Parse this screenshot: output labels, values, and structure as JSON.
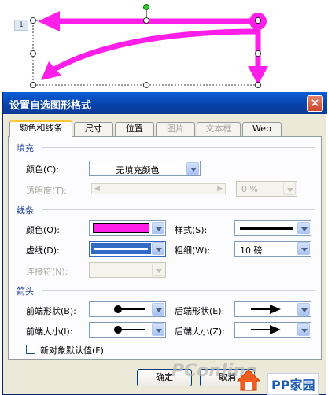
{
  "canvas": {
    "page_number": "1",
    "arrow_color": "#ff1fe8"
  },
  "dialog": {
    "title": "设置自选图形格式",
    "close_label": "×",
    "tabs": [
      {
        "label": "颜色和线条",
        "active": true,
        "disabled": false
      },
      {
        "label": "尺寸",
        "active": false,
        "disabled": false
      },
      {
        "label": "位置",
        "active": false,
        "disabled": false
      },
      {
        "label": "图片",
        "active": false,
        "disabled": true
      },
      {
        "label": "文本框",
        "active": false,
        "disabled": true
      },
      {
        "label": "Web",
        "active": false,
        "disabled": false
      }
    ],
    "fill": {
      "section": "填充",
      "color_label": "颜色(C):",
      "color_value": "无填充颜色",
      "transparency_label": "透明度(T):",
      "transparency_value": "0 %"
    },
    "line": {
      "section": "线条",
      "color_label": "颜色(O):",
      "color_value": "#ff1fe8",
      "style_label": "样式(S):",
      "dash_label": "虚线(D):",
      "weight_label": "粗细(W):",
      "weight_value": "10 磅",
      "connector_label": "连接符(N):"
    },
    "arrows": {
      "section": "箭头",
      "begin_style_label": "前端形状(B):",
      "end_style_label": "后端形状(E):",
      "begin_size_label": "前端大小(I):",
      "end_size_label": "后端大小(Z):"
    },
    "default_checkbox_label": "新对象默认值(F)",
    "ok_label": "确定",
    "cancel_label": "取消"
  },
  "watermark": {
    "brand": "PConline",
    "site": "PP家园"
  }
}
